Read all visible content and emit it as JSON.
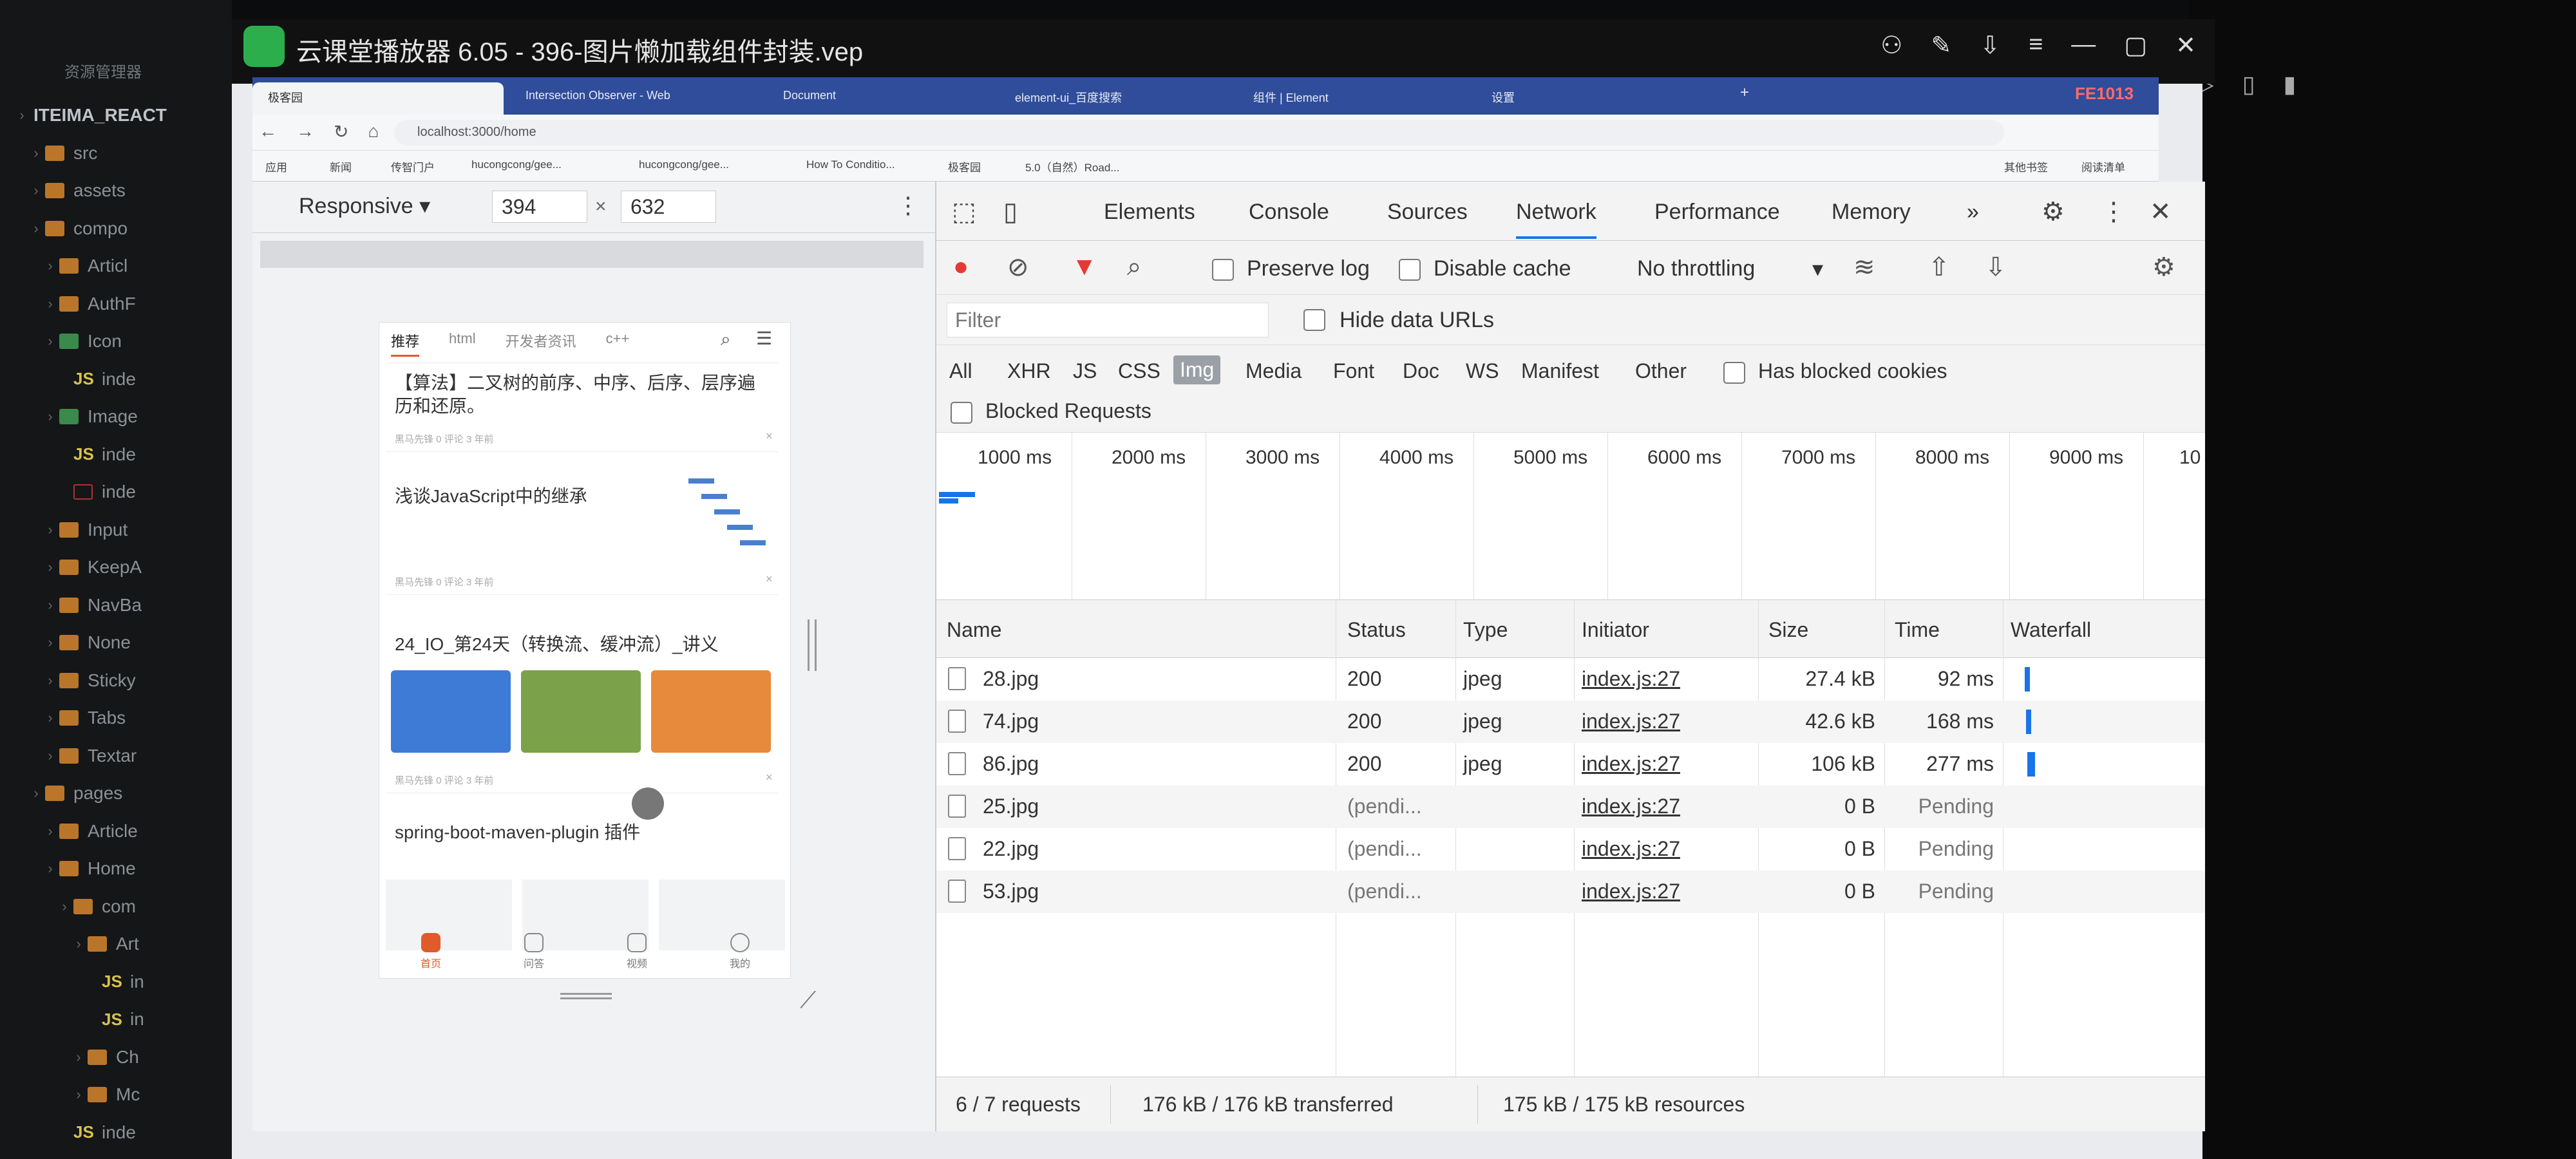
{
  "player": {
    "title": "云课堂播放器 6.05 - 396-图片懒加载组件封装.vep"
  },
  "explorer": {
    "header": "资源管理器",
    "items": [
      {
        "label": "ITEIMA_REACT",
        "t": "root"
      },
      {
        "label": "src",
        "t": "fold"
      },
      {
        "label": "assets",
        "t": "fold"
      },
      {
        "label": "compo",
        "t": "fold"
      },
      {
        "label": "Articl",
        "t": "fold"
      },
      {
        "label": "AuthF",
        "t": "fold"
      },
      {
        "label": "Icon",
        "t": "foldg"
      },
      {
        "label": "inde",
        "t": "js"
      },
      {
        "label": "Image",
        "t": "foldg"
      },
      {
        "label": "inde",
        "t": "js"
      },
      {
        "label": "inde",
        "t": "git"
      },
      {
        "label": "Input",
        "t": "fold"
      },
      {
        "label": "KeepA",
        "t": "fold"
      },
      {
        "label": "NavBa",
        "t": "fold"
      },
      {
        "label": "None",
        "t": "fold"
      },
      {
        "label": "Sticky",
        "t": "fold"
      },
      {
        "label": "Tabs",
        "t": "fold"
      },
      {
        "label": "Textar",
        "t": "fold"
      },
      {
        "label": "pages",
        "t": "fold"
      },
      {
        "label": "Article",
        "t": "fold"
      },
      {
        "label": "Home",
        "t": "fold"
      },
      {
        "label": "com",
        "t": "fold"
      },
      {
        "label": "Art",
        "t": "fold"
      },
      {
        "label": "in",
        "t": "js"
      },
      {
        "label": "in",
        "t": "js"
      },
      {
        "label": "Ch",
        "t": "fold"
      },
      {
        "label": "Mc",
        "t": "fold"
      },
      {
        "label": "inde",
        "t": "js"
      }
    ]
  },
  "browser": {
    "tabs": [
      "极客园",
      "Intersection Observer - Web",
      "Document",
      "element-ui_百度搜索",
      "组件 | Element",
      "设置"
    ],
    "window_text": "FE1013",
    "url": "localhost:3000/home",
    "bookmarks": [
      "应用",
      "新闻",
      "传智门户",
      "hucongcong/gee...",
      "hucongcong/gee...",
      "How To Conditio...",
      "极客园",
      "5.0（自然）Road..."
    ],
    "bookmarks_right": [
      "其他书签",
      "阅读清单"
    ]
  },
  "device": {
    "mode": "Responsive",
    "width": "394",
    "height": "632",
    "x": "×"
  },
  "phone": {
    "tabs": [
      "推荐",
      "html",
      "开发者资讯",
      "c++"
    ],
    "articles": [
      {
        "title": "【算法】二叉树的前序、中序、后序、层序遍历和还原。",
        "meta": "黑马先锋  0 评论  3 年前"
      },
      {
        "title": "浅谈JavaScript中的继承",
        "meta": "黑马先锋  0 评论  3 年前"
      },
      {
        "title": "24_IO_第24天（转换流、缓冲流）_讲义",
        "meta": "黑马先锋  0 评论  3 年前"
      },
      {
        "title": "spring-boot-maven-plugin 插件",
        "meta": ""
      }
    ],
    "nav": [
      "首页",
      "问答",
      "视频",
      "我的"
    ]
  },
  "devtools": {
    "tabs": [
      "Elements",
      "Console",
      "Sources",
      "Network",
      "Performance",
      "Memory"
    ],
    "more": "»",
    "toolbar": {
      "preserve_log": "Preserve log",
      "disable_cache": "Disable cache",
      "throttle": "No throttling"
    },
    "filter": {
      "placeholder": "Filter",
      "hide_data_urls": "Hide data URLs"
    },
    "types": [
      "All",
      "XHR",
      "JS",
      "CSS",
      "Img",
      "Media",
      "Font",
      "Doc",
      "WS",
      "Manifest",
      "Other"
    ],
    "has_blocked_cookies": "Has blocked cookies",
    "blocked_requests": "Blocked Requests",
    "timeline_ticks": [
      "1000 ms",
      "2000 ms",
      "3000 ms",
      "4000 ms",
      "5000 ms",
      "6000 ms",
      "7000 ms",
      "8000 ms",
      "9000 ms",
      "10"
    ],
    "columns": [
      "Name",
      "Status",
      "Type",
      "Initiator",
      "Size",
      "Time",
      "Waterfall"
    ],
    "rows": [
      {
        "name": "28.jpg",
        "status": "200",
        "type": "jpeg",
        "initiator": "index.js:27",
        "size": "27.4 kB",
        "time": "92 ms"
      },
      {
        "name": "74.jpg",
        "status": "200",
        "type": "jpeg",
        "initiator": "index.js:27",
        "size": "42.6 kB",
        "time": "168 ms"
      },
      {
        "name": "86.jpg",
        "status": "200",
        "type": "jpeg",
        "initiator": "index.js:27",
        "size": "106 kB",
        "time": "277 ms"
      },
      {
        "name": "25.jpg",
        "status": "(pendi...",
        "type": "",
        "initiator": "index.js:27",
        "size": "0 B",
        "time": "Pending"
      },
      {
        "name": "22.jpg",
        "status": "(pendi...",
        "type": "",
        "initiator": "index.js:27",
        "size": "0 B",
        "time": "Pending"
      },
      {
        "name": "53.jpg",
        "status": "(pendi...",
        "type": "",
        "initiator": "index.js:27",
        "size": "0 B",
        "time": "Pending"
      }
    ],
    "status": {
      "requests": "6 / 7 requests",
      "transferred": "176 kB / 176 kB transferred",
      "resources": "175 kB / 175 kB resources"
    }
  }
}
